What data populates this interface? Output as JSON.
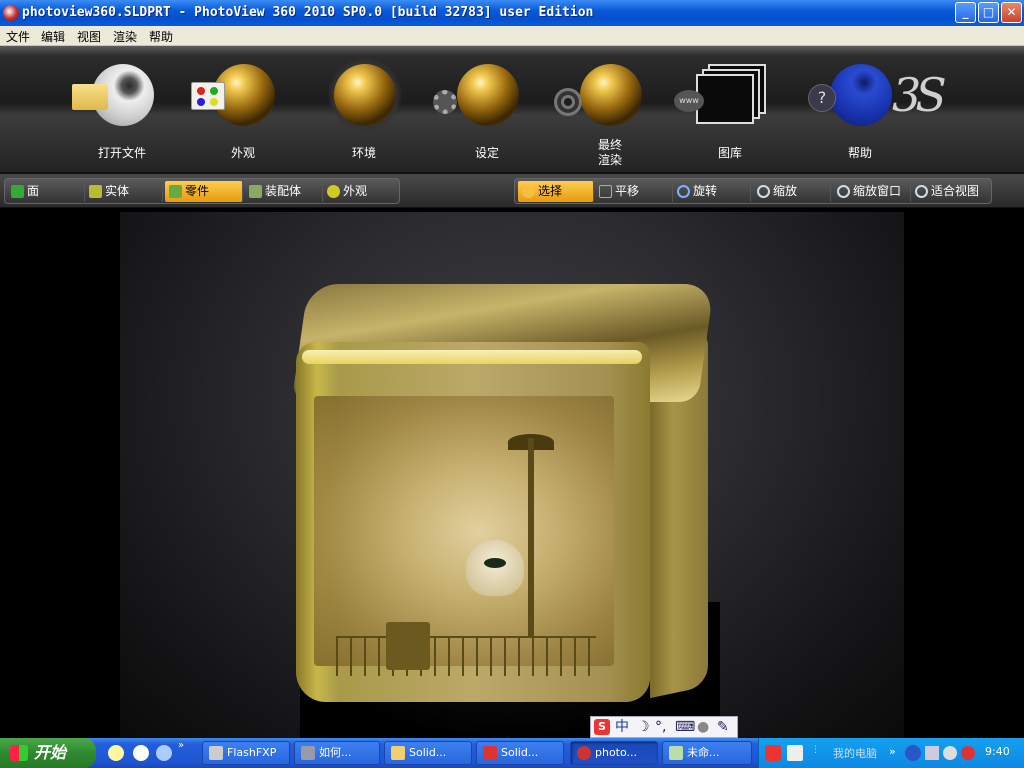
{
  "window": {
    "title": "photoview360.SLDPRT - PhotoView 360 2010 SP0.0 [build 32783] user Edition",
    "min_label": "_",
    "max_label": "□",
    "close_label": "✕"
  },
  "menu": [
    "文件",
    "编辑",
    "视图",
    "渲染",
    "帮助"
  ],
  "ribbon": {
    "buttons": [
      {
        "label": "打开文件",
        "icon": "open-file-icon"
      },
      {
        "label": "外观",
        "icon": "appearance-icon"
      },
      {
        "label": "环境",
        "icon": "environment-icon"
      },
      {
        "label": "设定",
        "icon": "settings-icon"
      },
      {
        "label": "最终\n渲染",
        "icon": "final-render-icon"
      },
      {
        "label": "图库",
        "icon": "library-icon"
      },
      {
        "label": "帮助",
        "icon": "help-icon"
      }
    ],
    "www_text": "www",
    "help_glyph": "?",
    "logo_text": "3S"
  },
  "selection_filters": [
    {
      "label": "面",
      "icon": "face-icon",
      "selected": false
    },
    {
      "label": "实体",
      "icon": "solid-body-icon",
      "selected": false
    },
    {
      "label": "零件",
      "icon": "part-icon",
      "selected": true
    },
    {
      "label": "装配体",
      "icon": "assembly-icon",
      "selected": false
    },
    {
      "label": "外观",
      "icon": "appearance-filter-icon",
      "selected": false
    }
  ],
  "view_tools": [
    {
      "label": "选择",
      "icon": "select-icon",
      "selected": true
    },
    {
      "label": "平移",
      "icon": "pan-icon",
      "selected": false
    },
    {
      "label": "旋转",
      "icon": "rotate-icon",
      "selected": false
    },
    {
      "label": "缩放",
      "icon": "zoom-icon",
      "selected": false
    },
    {
      "label": "缩放窗口",
      "icon": "zoom-window-icon",
      "selected": false
    },
    {
      "label": "适合视图",
      "icon": "fit-view-icon",
      "selected": false
    }
  ],
  "ime_bar": {
    "mode": "中"
  },
  "taskbar": {
    "start_label": "开始",
    "tasks": [
      {
        "label": "FlashFXP",
        "icon": "flashfxp-icon",
        "active": false
      },
      {
        "label": "如何...",
        "icon": "doc-icon",
        "active": false
      },
      {
        "label": "Solid...",
        "icon": "folder-icon",
        "active": false
      },
      {
        "label": "Solid...",
        "icon": "solidworks-icon",
        "active": false
      },
      {
        "label": "photo...",
        "icon": "photoview-icon",
        "active": true
      },
      {
        "label": "未命...",
        "icon": "paint-icon",
        "active": false
      }
    ],
    "tray_label": "我的电脑",
    "clock": "9:40"
  },
  "colors": {
    "accent_selected": "#f0a820",
    "titlebar": "#0a5ad8",
    "taskbar": "#245edb",
    "start": "#2f8a2f"
  }
}
